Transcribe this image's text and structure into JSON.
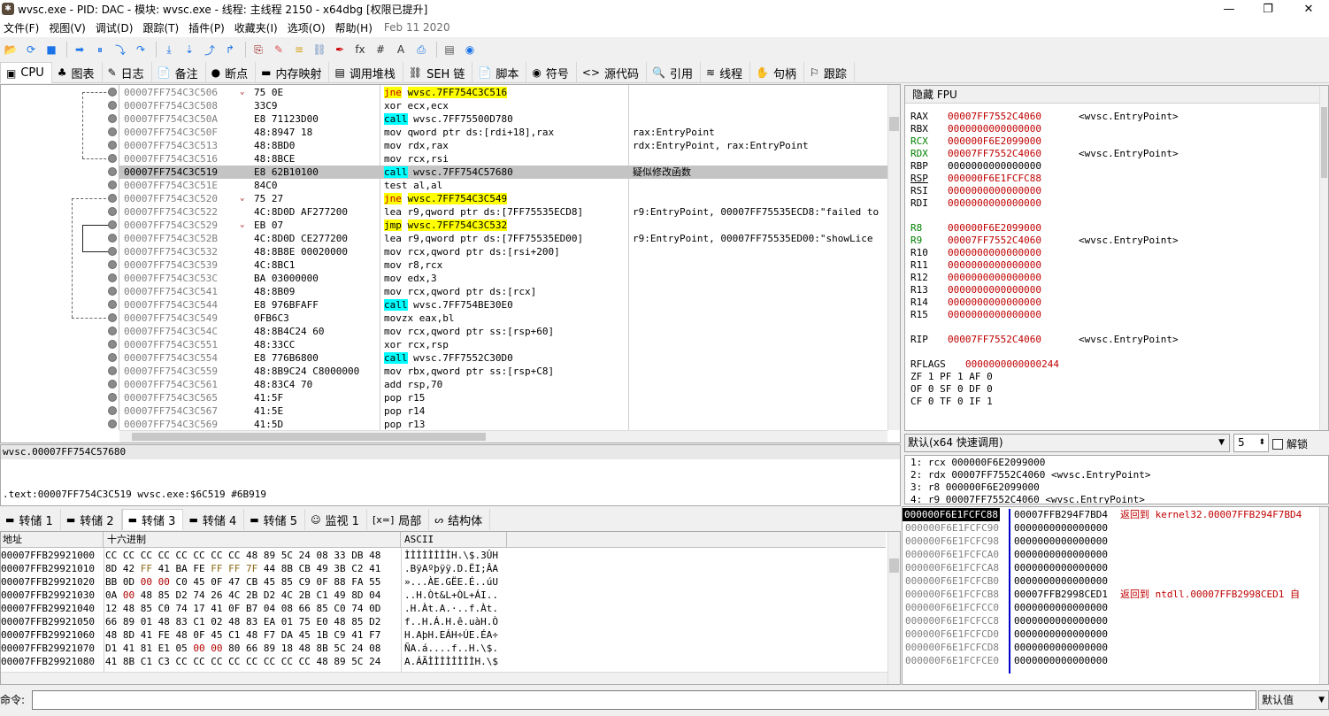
{
  "window": {
    "title": "wvsc.exe - PID: DAC - 模块: wvsc.exe - 线程: 主线程 2150 - x64dbg [权限已提升]",
    "minimize": "—",
    "maximize": "❐",
    "close": "✕"
  },
  "menu": {
    "items": [
      "文件(F)",
      "视图(V)",
      "调试(D)",
      "跟踪(T)",
      "插件(P)",
      "收藏夹(I)",
      "选项(O)",
      "帮助(H)"
    ],
    "date": "Feb 11 2020"
  },
  "toolbar": {
    "glyphs": [
      "📂",
      "⟳",
      "■",
      "➡",
      "⏸",
      "⤵",
      "↷",
      "⤓",
      "⇣",
      "⤴",
      "↱",
      "⎘",
      "✎",
      "≡",
      "⛓",
      "✒",
      "fx",
      "#",
      "A",
      "⎙",
      "▤",
      "◉"
    ]
  },
  "tabs": [
    {
      "icon": "▣",
      "label": "CPU"
    },
    {
      "icon": "♣",
      "label": "图表"
    },
    {
      "icon": "✎",
      "label": "日志"
    },
    {
      "icon": "📄",
      "label": "备注"
    },
    {
      "icon": "●",
      "label": "断点"
    },
    {
      "icon": "▬",
      "label": "内存映射"
    },
    {
      "icon": "▤",
      "label": "调用堆栈"
    },
    {
      "icon": "⛓",
      "label": "SEH 链"
    },
    {
      "icon": "📄",
      "label": "脚本"
    },
    {
      "icon": "◉",
      "label": "符号"
    },
    {
      "icon": "<>",
      "label": "源代码"
    },
    {
      "icon": "🔍",
      "label": "引用"
    },
    {
      "icon": "≋",
      "label": "线程"
    },
    {
      "icon": "✋",
      "label": "句柄"
    },
    {
      "icon": "⚐",
      "label": "跟踪"
    }
  ],
  "disasm": {
    "rows": [
      {
        "addr": "00007FF754C3C506",
        "arrow": "⌄",
        "bytes": "75 0E",
        "mn": "jne",
        "op": "wvsc.7FF754C3C516",
        "kind": "jne",
        "cmt": ""
      },
      {
        "addr": "00007FF754C3C508",
        "arrow": "",
        "bytes": "33C9",
        "mn": "xor",
        "op": "ecx,ecx",
        "kind": "plain",
        "cmt": ""
      },
      {
        "addr": "00007FF754C3C50A",
        "arrow": "",
        "bytes": "E8 71123D00",
        "mn": "call",
        "op": "wvsc.7FF75500D780",
        "kind": "call",
        "cmt": ""
      },
      {
        "addr": "00007FF754C3C50F",
        "arrow": "",
        "bytes": "48:8947 18",
        "mn": "mov",
        "op": "qword ptr ds:[rdi+18],rax",
        "kind": "plain",
        "cmt": "rax:EntryPoint"
      },
      {
        "addr": "00007FF754C3C513",
        "arrow": "",
        "bytes": "48:8BD0",
        "mn": "mov",
        "op": "rdx,rax",
        "kind": "plain",
        "cmt": "rdx:EntryPoint, rax:EntryPoint"
      },
      {
        "addr": "00007FF754C3C516",
        "arrow": "",
        "bytes": "48:8BCE",
        "mn": "mov",
        "op": "rcx,rsi",
        "kind": "plain",
        "cmt": ""
      },
      {
        "addr": "00007FF754C3C519",
        "arrow": "",
        "bytes": "E8 62B10100",
        "mn": "call",
        "op": "wvsc.7FF754C57680",
        "kind": "call",
        "cmt": "疑似修改函数",
        "sel": true
      },
      {
        "addr": "00007FF754C3C51E",
        "arrow": "",
        "bytes": "84C0",
        "mn": "test",
        "op": "al,al",
        "kind": "plain",
        "cmt": ""
      },
      {
        "addr": "00007FF754C3C520",
        "arrow": "⌄",
        "bytes": "75 27",
        "mn": "jne",
        "op": "wvsc.7FF754C3C549",
        "kind": "jne",
        "cmt": ""
      },
      {
        "addr": "00007FF754C3C522",
        "arrow": "",
        "bytes": "4C:8D0D AF277200",
        "mn": "lea",
        "op": "r9,qword ptr ds:[7FF75535ECD8]",
        "kind": "plain",
        "cmt": "r9:EntryPoint, 00007FF75535ECD8:\"failed to"
      },
      {
        "addr": "00007FF754C3C529",
        "arrow": "⌄",
        "bytes": "EB 07",
        "mn": "jmp",
        "op": "wvsc.7FF754C3C532",
        "kind": "jmp",
        "cmt": ""
      },
      {
        "addr": "00007FF754C3C52B",
        "arrow": "",
        "bytes": "4C:8D0D CE277200",
        "mn": "lea",
        "op": "r9,qword ptr ds:[7FF75535ED00]",
        "kind": "plain",
        "cmt": "r9:EntryPoint, 00007FF75535ED00:\"showLice"
      },
      {
        "addr": "00007FF754C3C532",
        "arrow": "",
        "bytes": "48:8B8E 00020000",
        "mn": "mov",
        "op": "rcx,qword ptr ds:[rsi+200]",
        "kind": "plain",
        "cmt": ""
      },
      {
        "addr": "00007FF754C3C539",
        "arrow": "",
        "bytes": "4C:8BC1",
        "mn": "mov",
        "op": "r8,rcx",
        "kind": "plain",
        "cmt": ""
      },
      {
        "addr": "00007FF754C3C53C",
        "arrow": "",
        "bytes": "BA 03000000",
        "mn": "mov",
        "op": "edx,3",
        "kind": "plain",
        "cmt": ""
      },
      {
        "addr": "00007FF754C3C541",
        "arrow": "",
        "bytes": "48:8B09",
        "mn": "mov",
        "op": "rcx,qword ptr ds:[rcx]",
        "kind": "plain",
        "cmt": ""
      },
      {
        "addr": "00007FF754C3C544",
        "arrow": "",
        "bytes": "E8 976BFAFF",
        "mn": "call",
        "op": "wvsc.7FF754BE30E0",
        "kind": "call",
        "cmt": ""
      },
      {
        "addr": "00007FF754C3C549",
        "arrow": "",
        "bytes": "0FB6C3",
        "mn": "movzx",
        "op": "eax,bl",
        "kind": "plain",
        "cmt": ""
      },
      {
        "addr": "00007FF754C3C54C",
        "arrow": "",
        "bytes": "48:8B4C24 60",
        "mn": "mov",
        "op": "rcx,qword ptr ss:[rsp+60]",
        "kind": "plain",
        "cmt": ""
      },
      {
        "addr": "00007FF754C3C551",
        "arrow": "",
        "bytes": "48:33CC",
        "mn": "xor",
        "op": "rcx,rsp",
        "kind": "plain",
        "cmt": ""
      },
      {
        "addr": "00007FF754C3C554",
        "arrow": "",
        "bytes": "E8 776B6800",
        "mn": "call",
        "op": "wvsc.7FF7552C30D0",
        "kind": "call",
        "cmt": ""
      },
      {
        "addr": "00007FF754C3C559",
        "arrow": "",
        "bytes": "48:8B9C24 C8000000",
        "mn": "mov",
        "op": "rbx,qword ptr ss:[rsp+C8]",
        "kind": "plain",
        "cmt": ""
      },
      {
        "addr": "00007FF754C3C561",
        "arrow": "",
        "bytes": "48:83C4 70",
        "mn": "add",
        "op": "rsp,70",
        "kind": "plain",
        "cmt": ""
      },
      {
        "addr": "00007FF754C3C565",
        "arrow": "",
        "bytes": "41:5F",
        "mn": "pop",
        "op": "r15",
        "kind": "plain",
        "cmt": ""
      },
      {
        "addr": "00007FF754C3C567",
        "arrow": "",
        "bytes": "41:5E",
        "mn": "pop",
        "op": "r14",
        "kind": "plain",
        "cmt": ""
      },
      {
        "addr": "00007FF754C3C569",
        "arrow": "",
        "bytes": "41:5D",
        "mn": "pop",
        "op": "r13",
        "kind": "plain",
        "cmt": ""
      }
    ]
  },
  "info": {
    "line1": "wvsc.00007FF754C57680",
    "line2": ".text:00007FF754C3C519 wvsc.exe:$6C519 #6B919"
  },
  "registers": {
    "header": "隐藏 FPU",
    "rows": [
      {
        "name": "RAX",
        "val": "00007FF7552C4060",
        "cmt": "<wvsc.EntryPoint>",
        "nameColor": "#000",
        "valColor": "#c00000"
      },
      {
        "name": "RBX",
        "val": "0000000000000000",
        "cmt": "",
        "nameColor": "#000",
        "valColor": "#c00000"
      },
      {
        "name": "RCX",
        "val": "000000F6E2099000",
        "cmt": "",
        "nameColor": "#008000",
        "valColor": "#c00000"
      },
      {
        "name": "RDX",
        "val": "00007FF7552C4060",
        "cmt": "<wvsc.EntryPoint>",
        "nameColor": "#008000",
        "valColor": "#c00000"
      },
      {
        "name": "RBP",
        "val": "0000000000000000",
        "cmt": "",
        "nameColor": "#000",
        "valColor": "#000"
      },
      {
        "name": "RSP",
        "val": "000000F6E1FCFC88",
        "cmt": "",
        "nameColor": "#000",
        "valColor": "#c00000"
      },
      {
        "name": "RSI",
        "val": "0000000000000000",
        "cmt": "",
        "nameColor": "#000",
        "valColor": "#c00000"
      },
      {
        "name": "RDI",
        "val": "0000000000000000",
        "cmt": "",
        "nameColor": "#000",
        "valColor": "#c00000"
      },
      {
        "name": "R8",
        "val": "000000F6E2099000",
        "cmt": "",
        "nameColor": "#008000",
        "valColor": "#c00000"
      },
      {
        "name": "R9",
        "val": "00007FF7552C4060",
        "cmt": "<wvsc.EntryPoint>",
        "nameColor": "#008000",
        "valColor": "#c00000"
      },
      {
        "name": "R10",
        "val": "0000000000000000",
        "cmt": "",
        "nameColor": "#000",
        "valColor": "#c00000"
      },
      {
        "name": "R11",
        "val": "0000000000000000",
        "cmt": "",
        "nameColor": "#000",
        "valColor": "#c00000"
      },
      {
        "name": "R12",
        "val": "0000000000000000",
        "cmt": "",
        "nameColor": "#000",
        "valColor": "#c00000"
      },
      {
        "name": "R13",
        "val": "0000000000000000",
        "cmt": "",
        "nameColor": "#000",
        "valColor": "#c00000"
      },
      {
        "name": "R14",
        "val": "0000000000000000",
        "cmt": "",
        "nameColor": "#000",
        "valColor": "#c00000"
      },
      {
        "name": "R15",
        "val": "0000000000000000",
        "cmt": "",
        "nameColor": "#000",
        "valColor": "#c00000"
      },
      {
        "name": "RIP",
        "val": "00007FF7552C4060",
        "cmt": "<wvsc.EntryPoint>",
        "nameColor": "#000",
        "valColor": "#c00000"
      }
    ],
    "rflags_label": "RFLAGS",
    "rflags_val": "0000000000000244",
    "flags1": "ZF 1  PF 1  AF 0",
    "flags2": "OF 0  SF 0  DF 0",
    "flags3": "CF 0  TF 0  IF 1"
  },
  "callconv": {
    "label": "默认(x64 快速调用)",
    "count": "5",
    "lock": "解锁",
    "args": [
      "1: rcx 000000F6E2099000",
      "2: rdx 00007FF7552C4060 <wvsc.EntryPoint>",
      "3: r8 000000F6E2099000",
      "4: r9 00007FF7552C4060 <wvsc.EntryPoint>"
    ]
  },
  "dumptabs": [
    {
      "icon": "▬",
      "label": "转储 1"
    },
    {
      "icon": "▬",
      "label": "转储 2"
    },
    {
      "icon": "▬",
      "label": "转储 3"
    },
    {
      "icon": "▬",
      "label": "转储 4"
    },
    {
      "icon": "▬",
      "label": "转储 5"
    },
    {
      "icon": "☺",
      "label": "监视 1"
    },
    {
      "icon": "[x=]",
      "label": "局部"
    },
    {
      "icon": "ᔕ",
      "label": "结构体"
    }
  ],
  "dump": {
    "hdr_addr": "地址",
    "hdr_hex": "十六进制",
    "hdr_ascii": "ASCII",
    "rows": [
      {
        "addr": "00007FFB29921000",
        "hex": "CC CC CC CC CC CC CC CC 48 89 5C 24 08 33 DB 48",
        "ascii": "ÌÌÌÌÌÌÌÌH.\\$.3ÛH"
      },
      {
        "addr": "00007FFB29921010",
        "hex": "8D 42 FF 41 BA FE FF FF 7F 44 8B CB 49 3B C2 41",
        "ascii": ".BÿAºþÿÿ.D.ËI;ÂA"
      },
      {
        "addr": "00007FFB29921020",
        "hex": "BB 0D 00 00 C0 45 0F 47 CB 45 85 C9 0F 88 FA 55",
        "ascii": "»...ÀE.GËE.É..úU"
      },
      {
        "addr": "00007FFB29921030",
        "hex": "0A 00 48 85 D2 74 26 4C 2B D2 4C 2B C1 49 8D 04",
        "ascii": "..H.Òt&L+ÒL+ÁI.."
      },
      {
        "addr": "00007FFB29921040",
        "hex": "12 48 85 C0 74 17 41 0F B7 04 08 66 85 C0 74 0D",
        "ascii": ".H.Àt.A.·..f.Àt."
      },
      {
        "addr": "00007FFB29921050",
        "hex": "66 89 01 48 83 C1 02 48 83 EA 01 75 E0 48 85 D2",
        "ascii": "f..H.Á.H.ê.uàH.Ò"
      },
      {
        "addr": "00007FFB29921060",
        "hex": "48 8D 41 FE 48 0F 45 C1 48 F7 DA 45 1B C9 41 F7",
        "ascii": "H.AþH.EÁH÷ÚE.ÉA÷"
      },
      {
        "addr": "00007FFB29921070",
        "hex": "D1 41 81 E1 05 00 00 80 66 89 18 48 8B 5C 24 08",
        "ascii": "ÑA.á....f..H.\\$."
      },
      {
        "addr": "00007FFB29921080",
        "hex": "41 8B C1 C3 CC CC CC CC CC CC CC CC 48 89 5C 24",
        "ascii": "A.ÁÃÌÌÌÌÌÌÌÌH.\\$"
      }
    ]
  },
  "stack": {
    "rows": [
      {
        "addr": "000000F6E1FCFC88",
        "val": "00007FFB294F7BD4",
        "cmt": "返回到 kernel32.00007FFB294F7BD4",
        "cur": true
      },
      {
        "addr": "000000F6E1FCFC90",
        "val": "0000000000000000",
        "cmt": ""
      },
      {
        "addr": "000000F6E1FCFC98",
        "val": "0000000000000000",
        "cmt": ""
      },
      {
        "addr": "000000F6E1FCFCA0",
        "val": "0000000000000000",
        "cmt": ""
      },
      {
        "addr": "000000F6E1FCFCA8",
        "val": "0000000000000000",
        "cmt": ""
      },
      {
        "addr": "000000F6E1FCFCB0",
        "val": "0000000000000000",
        "cmt": ""
      },
      {
        "addr": "000000F6E1FCFCB8",
        "val": "00007FFB2998CED1",
        "cmt": "返回到 ntdll.00007FFB2998CED1 自"
      },
      {
        "addr": "000000F6E1FCFCC0",
        "val": "0000000000000000",
        "cmt": ""
      },
      {
        "addr": "000000F6E1FCFCC8",
        "val": "0000000000000000",
        "cmt": ""
      },
      {
        "addr": "000000F6E1FCFCD0",
        "val": "0000000000000000",
        "cmt": ""
      },
      {
        "addr": "000000F6E1FCFCD8",
        "val": "0000000000000000",
        "cmt": ""
      },
      {
        "addr": "000000F6E1FCFCE0",
        "val": "0000000000000000",
        "cmt": ""
      }
    ]
  },
  "command": {
    "label": "命令:",
    "value": "",
    "default_label": "默认值"
  }
}
